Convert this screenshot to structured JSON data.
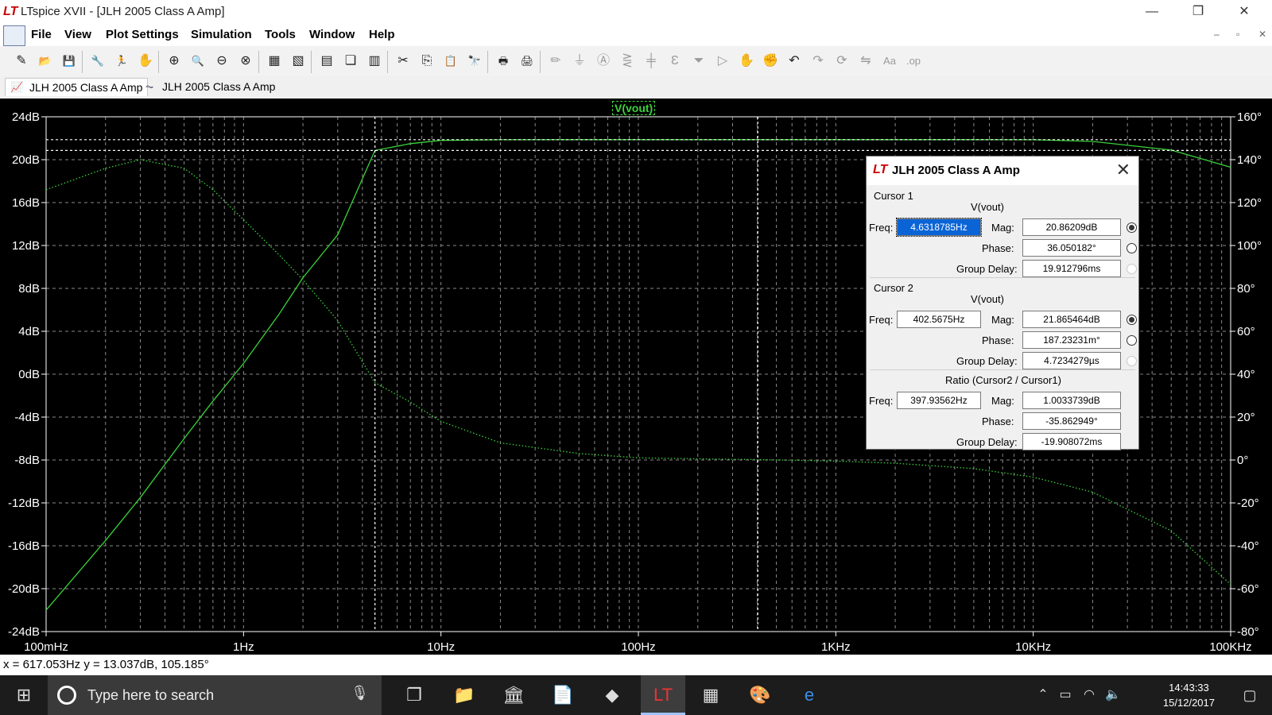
{
  "window": {
    "title": "LTspice XVII - [JLH 2005 Class A Amp]",
    "logo": "LT",
    "controls": [
      "—",
      "❐",
      "✕"
    ]
  },
  "menu": [
    "File",
    "View",
    "Plot Settings",
    "Simulation",
    "Tools",
    "Window",
    "Help"
  ],
  "mdi_controls": [
    "–",
    "▫",
    "✕"
  ],
  "toolbar": [
    {
      "icon": "new-schematic-icon",
      "glyph": "✎"
    },
    {
      "icon": "open-icon",
      "glyph": "📂"
    },
    {
      "icon": "save-icon",
      "glyph": "💾"
    },
    {
      "icon": "control-panel-icon",
      "glyph": "🔧"
    },
    {
      "icon": "run-icon",
      "glyph": "🏃"
    },
    {
      "icon": "halt-icon",
      "glyph": "✋"
    },
    {
      "icon": "zoom-area-icon",
      "glyph": "⊕"
    },
    {
      "icon": "zoom-in-icon",
      "glyph": "🔍"
    },
    {
      "icon": "zoom-out-icon",
      "glyph": "⊖"
    },
    {
      "icon": "zoom-fit-icon",
      "glyph": "⊗"
    },
    {
      "icon": "autorange-icon",
      "glyph": "▦"
    },
    {
      "icon": "grid-icon",
      "glyph": "▧"
    },
    {
      "icon": "tile-horizontal-icon",
      "glyph": "▤"
    },
    {
      "icon": "cascade-icon",
      "glyph": "❏"
    },
    {
      "icon": "tile-vertical-icon",
      "glyph": "▥"
    },
    {
      "icon": "cut-icon",
      "glyph": "✂"
    },
    {
      "icon": "copy-icon",
      "glyph": "⎘"
    },
    {
      "icon": "paste-icon",
      "glyph": "📋"
    },
    {
      "icon": "find-icon",
      "glyph": "🔭"
    },
    {
      "icon": "print-icon",
      "glyph": "🖶"
    },
    {
      "icon": "print-preview-icon",
      "glyph": "🖨"
    },
    {
      "icon": "wire-icon",
      "glyph": "✏",
      "dim": true
    },
    {
      "icon": "ground-icon",
      "glyph": "⏚",
      "dim": true
    },
    {
      "icon": "label-icon",
      "glyph": "Ⓐ",
      "dim": true
    },
    {
      "icon": "resistor-icon",
      "glyph": "⋛",
      "dim": true
    },
    {
      "icon": "capacitor-icon",
      "glyph": "╪",
      "dim": true
    },
    {
      "icon": "inductor-icon",
      "glyph": "Ɛ",
      "dim": true
    },
    {
      "icon": "diode-icon",
      "glyph": "⏷",
      "dim": true
    },
    {
      "icon": "component-icon",
      "glyph": "▷",
      "dim": true
    },
    {
      "icon": "move-icon",
      "glyph": "✋",
      "dim": true
    },
    {
      "icon": "drag-icon",
      "glyph": "✊",
      "dim": true
    },
    {
      "icon": "undo-icon",
      "glyph": "↶"
    },
    {
      "icon": "redo-icon",
      "glyph": "↷",
      "dim": true
    },
    {
      "icon": "rotate-icon",
      "glyph": "⟳",
      "dim": true
    },
    {
      "icon": "mirror-icon",
      "glyph": "⇋",
      "dim": true
    },
    {
      "icon": "text-icon",
      "glyph": "Aa",
      "dim": true
    },
    {
      "icon": "spice-directive-icon",
      "glyph": ".op",
      "dim": true
    }
  ],
  "tabs": [
    {
      "label": "JLH 2005 Class A Amp",
      "icon": "waveform-icon",
      "glyph": "📈",
      "active": true
    },
    {
      "label": "JLH 2005 Class A Amp",
      "icon": "schematic-icon",
      "glyph": "⏦",
      "active": false
    }
  ],
  "plot": {
    "trace_label": "V(vout)",
    "trace_color": "#3ad23a",
    "left_ticks": [
      "24dB",
      "20dB",
      "16dB",
      "12dB",
      "8dB",
      "4dB",
      "0dB",
      "-4dB",
      "-8dB",
      "-12dB",
      "-16dB",
      "-20dB",
      "-24dB"
    ],
    "right_ticks": [
      "160°",
      "140°",
      "120°",
      "100°",
      "80°",
      "60°",
      "40°",
      "20°",
      "0°",
      "-20°",
      "-40°",
      "-60°",
      "-80°"
    ],
    "x_ticks": [
      "100mHz",
      "1Hz",
      "10Hz",
      "100Hz",
      "1KHz",
      "10KHz",
      "100KHz"
    ]
  },
  "chart_data": {
    "type": "line",
    "x_scale": "log",
    "xlim": [
      0.1,
      100000
    ],
    "ylim_left": [
      -24,
      24
    ],
    "ylim_right": [
      -80,
      160
    ],
    "xlabel": "",
    "ylabel": "",
    "grid": true,
    "series": [
      {
        "name": "V(vout)",
        "axis": "left",
        "style": "solid",
        "x": [
          0.1,
          0.2,
          0.3,
          0.5,
          0.7,
          1.0,
          1.5,
          2.0,
          3.0,
          4.63,
          7.0,
          10,
          20,
          50,
          100,
          200,
          500,
          1000,
          2000,
          5000,
          10000,
          20000,
          50000,
          100000
        ],
        "values": [
          -22.0,
          -15.5,
          -11.5,
          -6.0,
          -2.5,
          1.0,
          5.5,
          9.0,
          13.0,
          20.86,
          21.5,
          21.8,
          21.86,
          21.87,
          21.87,
          21.87,
          21.87,
          21.87,
          21.87,
          21.87,
          21.86,
          21.7,
          20.9,
          19.3
        ]
      },
      {
        "name": "V(vout)",
        "axis": "right",
        "style": "dotted",
        "x": [
          0.1,
          0.2,
          0.3,
          0.5,
          0.7,
          1.0,
          1.5,
          2.0,
          3.0,
          4.63,
          7.0,
          10,
          20,
          50,
          100,
          200,
          400,
          1000,
          2000,
          5000,
          10000,
          20000,
          50000,
          100000
        ],
        "values": [
          126,
          136,
          140,
          136,
          126,
          112,
          96,
          84,
          65,
          36.05,
          27,
          18,
          8,
          3,
          1,
          0.5,
          0.19,
          -0.5,
          -1.5,
          -4,
          -8,
          -15,
          -33,
          -58
        ]
      }
    ],
    "cursors": [
      {
        "name": "Cursor 1",
        "x": 4.6318785,
        "mag": 20.86209
      },
      {
        "name": "Cursor 2",
        "x": 402.5675,
        "mag": 21.865464
      }
    ]
  },
  "dialog": {
    "title": "JLH 2005 Class A Amp",
    "cursor1": {
      "heading": "Cursor 1",
      "trace": "V(vout)",
      "freq_label": "Freq:",
      "freq": "4.6318785Hz",
      "mag_label": "Mag:",
      "mag": "20.86209dB",
      "phase_label": "Phase:",
      "phase": "36.050182°",
      "gd_label": "Group Delay:",
      "gd": "19.912796ms"
    },
    "cursor2": {
      "heading": "Cursor 2",
      "trace": "V(vout)",
      "freq_label": "Freq:",
      "freq": "402.5675Hz",
      "mag_label": "Mag:",
      "mag": "21.865464dB",
      "phase_label": "Phase:",
      "phase": "187.23231m°",
      "gd_label": "Group Delay:",
      "gd": "4.7234279µs"
    },
    "ratio": {
      "heading": "Ratio (Cursor2 / Cursor1)",
      "freq_label": "Freq:",
      "freq": "397.93562Hz",
      "mag_label": "Mag:",
      "mag": "1.0033739dB",
      "phase_label": "Phase:",
      "phase": "-35.862949°",
      "gd_label": "Group Delay:",
      "gd": "-19.908072ms"
    }
  },
  "status": {
    "readout": "x = 617.053Hz    y = 13.037dB, 105.185°"
  },
  "taskbar": {
    "search_placeholder": "Type here to search",
    "time": "14:43:33",
    "date": "15/12/2017",
    "apps": [
      "task-view-icon",
      "file-explorer-icon",
      "bank-icon",
      "document-icon",
      "note-icon",
      "ltspice-icon",
      "calculator-icon",
      "paint-icon",
      "edge-icon"
    ]
  }
}
